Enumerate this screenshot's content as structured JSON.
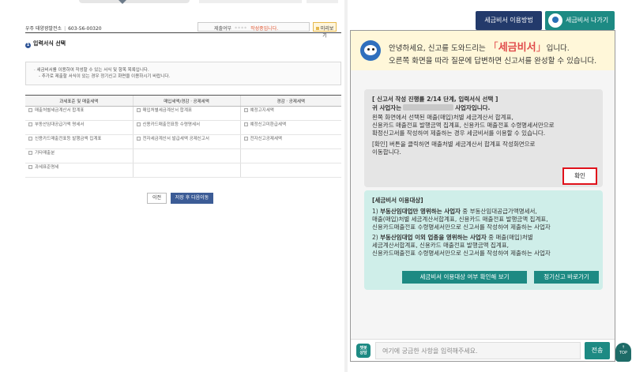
{
  "form": {
    "biz_name": "우주 태양광발전소",
    "biz_number": "603-56-00320",
    "status_label": "제출여부",
    "status_masked": "****",
    "status_value": "작성중입니다.",
    "preview_label": "미리보기",
    "section_title": "입력서식 선택",
    "section_num": "1",
    "notice_line1": "· 세금비서를 이용하여 작성할 수 있는 서식 및 항목 목록입니다.",
    "notice_line2": "- 추가로 제출할 서식이 있는 경우 정기신고 화면을 이용하시기 바랍니다.",
    "columns": [
      "과세표준 및 매출세액",
      "매입세액/경감ㆍ공제세액",
      "경감ㆍ공제세액"
    ],
    "rows": [
      [
        "매출처별세금계산서 합계표",
        "매입처별세금계산서 합계표",
        "예정고지세액"
      ],
      [
        "부동산임대공급가액 명세서",
        "신용카드매출전표등 수령명세서",
        "예정신고미환급세액"
      ],
      [
        "신용카드매출전표등 발행금액 집계표",
        "전자세금계산서 발급세액 공제신고서",
        "전자신고공제세액"
      ],
      [
        "기타매출분",
        "",
        ""
      ],
      [
        "과세표준명세",
        "",
        ""
      ]
    ],
    "prev_label": "이전",
    "next_label": "저장 후 다음이동"
  },
  "header": {
    "guide_label": "세금비서 이용방법",
    "exit_label": "세금비서 나가기"
  },
  "chat": {
    "greet_pre": "안녕하세요, 신고를 도와드리는 ",
    "greet_open": "「",
    "brand": "세금비서",
    "greet_close": "」",
    "greet_post": "입니다.",
    "greet_line2": "오른쪽 화면을 따라 질문에 답변하면 신고서를 완성할 수 있습니다.",
    "card1": {
      "title": "[ 신고서 작성 진행률 2/14 단계, 입력서식 선택 ]",
      "biz_pre": "귀 사업자는",
      "biz_post": "사업자입니다.",
      "desc1": "왼쪽 화면에서 선택된 매출(매입)처별 세금계산서 합계표,",
      "desc2": "신용카드 매출전표 발행금액 집계표, 신용카드 매출전표 수령명세서만으로",
      "desc3": "확정신고서를 작성하여 제출하는 경우 세금비서를 이용할 수 있습니다.",
      "desc4": "[확인] 버튼을 클릭하면 매출처별 세금계산서 합계표 작성화면으로",
      "desc5": "이동합니다.",
      "confirm_label": "확인"
    },
    "card2": {
      "title": "[세금비서 이용대상]",
      "p1_prefix": "1) ",
      "p1_bold": "부동산임대업만 영위하는 사업자",
      "p1_rest": " 중 부동산임대공급가액명세서,",
      "p1_line2": "매출(매입)처별 세금계산서합계표, 신용카드 매출전표 발행금액 집계표,",
      "p1_line3": "신용카드매출전표 수령명세서만으로 신고서를 작성하여 제출하는 사업자",
      "p2_prefix": "2) ",
      "p2_bold": "부동산임대업 이외 업종을 영위하는 사업자",
      "p2_rest": " 중 매출(매입)처별",
      "p2_line2": "세금계산서합계표, 신용카드 매출전표 발행금액 집계표,",
      "p2_line3": "신용카드매출전표 수령명세서만으로 신고서를 작성하여 제출하는 사업자",
      "btn1_label": "세금비서 이용대상 여부 확인해 보기",
      "btn2_label": "정기신고 바로가기"
    },
    "chatbot_line1": "챗봇",
    "chatbot_line2": "상담",
    "input_placeholder": "여기에 궁금한 사항을 입력해주세요.",
    "send_label": "전송"
  },
  "top_button": {
    "arrow": "↑",
    "label": "TOP"
  }
}
